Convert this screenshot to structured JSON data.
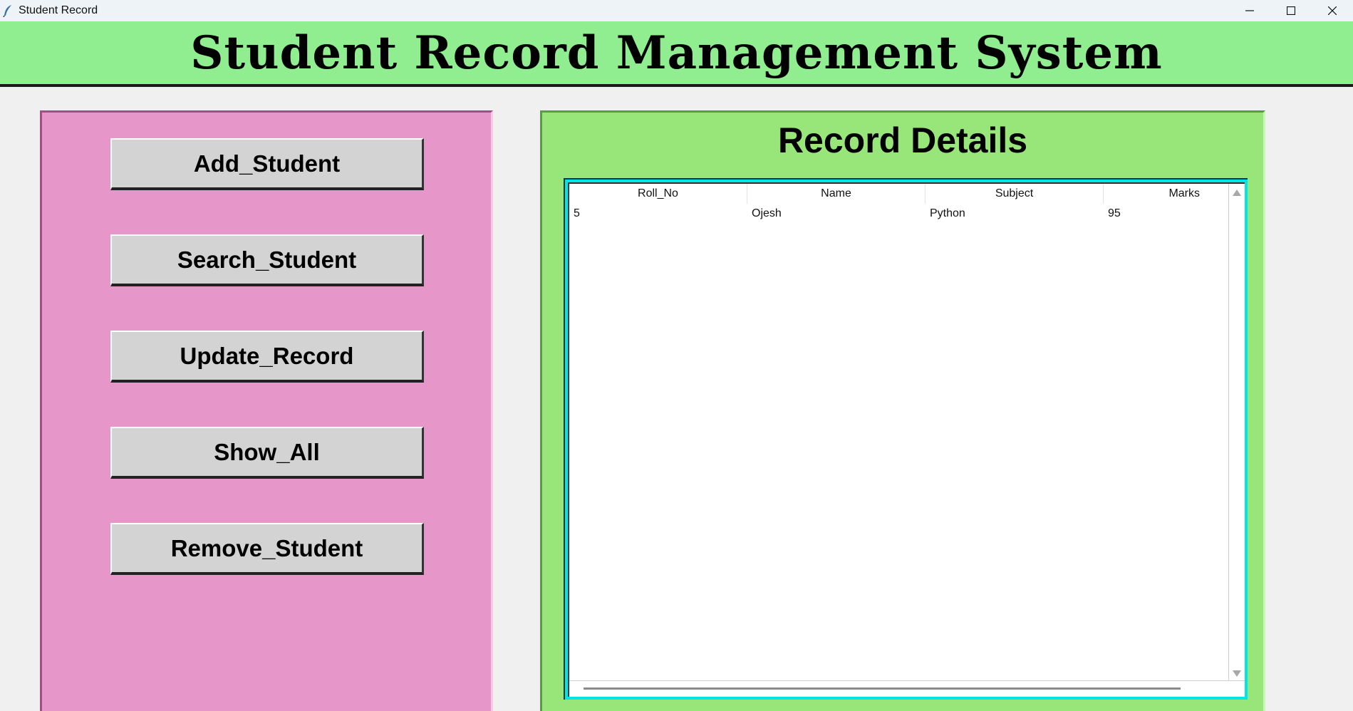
{
  "window": {
    "title": "Student Record",
    "controls": {
      "minimize": "minimize-icon",
      "maximize": "maximize-icon",
      "close": "close-icon"
    }
  },
  "header": {
    "title": "Student Record Management System"
  },
  "sidebar": {
    "buttons": [
      {
        "label": "Add_Student"
      },
      {
        "label": "Search_Student"
      },
      {
        "label": "Update_Record"
      },
      {
        "label": "Show_All"
      },
      {
        "label": "Remove_Student"
      }
    ]
  },
  "details": {
    "title": "Record Details",
    "columns": [
      "Roll_No",
      "Name",
      "Subject",
      "Marks"
    ],
    "rows": [
      [
        "5",
        "Ojesh",
        "Python",
        "95"
      ]
    ]
  },
  "colors": {
    "header_bg": "#90ee90",
    "left_panel_bg": "#e696c8",
    "right_panel_bg": "#98e67a",
    "table_frame": "#00e5e5",
    "button_bg": "#d3d3d3"
  }
}
